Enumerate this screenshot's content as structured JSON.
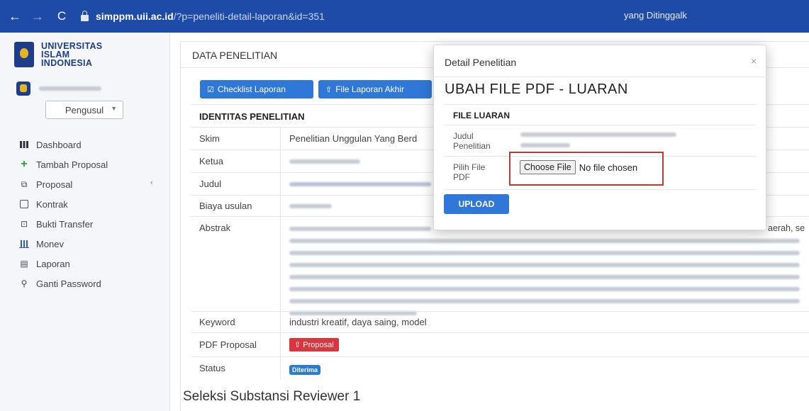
{
  "browser": {
    "back": "←",
    "forward": "→",
    "reload": "C",
    "url_host": "simppm.uii.ac.id",
    "url_path": "/?p=peneliti-detail-laporan&id=351",
    "cut_text": "yang Ditinggalk"
  },
  "sidebar": {
    "brand": [
      "UNIVERSITAS",
      "ISLAM",
      "INDONESIA"
    ],
    "role": "Pengusul",
    "items": [
      {
        "label": "Dashboard",
        "icon": "grid-icon"
      },
      {
        "label": "Tambah Proposal",
        "icon": "plus-icon"
      },
      {
        "label": "Proposal",
        "icon": "copy-icon"
      },
      {
        "label": "Kontrak",
        "icon": "file-icon"
      },
      {
        "label": "Bukti Transfer",
        "icon": "money-icon"
      },
      {
        "label": "Monev",
        "icon": "bar-chart-icon"
      },
      {
        "label": "Laporan",
        "icon": "document-icon"
      },
      {
        "label": "Ganti Password",
        "icon": "key-icon"
      }
    ]
  },
  "main": {
    "title": "DATA PENELITIAN",
    "btn_checklist": "Checklist Laporan",
    "btn_file": "File Laporan Akhir",
    "section_identitas": "IDENTITAS PENELITIAN",
    "rows": {
      "skim_label": "Skim",
      "skim_value": "Penelitian Unggulan Yang Berd",
      "ketua_label": "Ketua",
      "judul_label": "Judul",
      "biaya_label": "Biaya usulan",
      "abstrak_label": "Abstrak",
      "abstrak_cut": "aerah, se",
      "keyword_label": "Keyword",
      "keyword_value": "industri kreatif, daya saing, model",
      "pdf_label": "PDF Proposal",
      "pdf_button": "Proposal",
      "status_label": "Status",
      "status_value": "Diterima"
    },
    "section_reviewer": "Seleksi Substansi Reviewer 1"
  },
  "modal": {
    "title": "Detail Penelitian",
    "close": "×",
    "heading": "UBAH FILE PDF - LUARAN",
    "subheading": "FILE LUARAN",
    "judul_label_1": "Judul",
    "judul_label_2": "Penelitian",
    "pilih_label_1": "Pilih File",
    "pilih_label_2": "PDF",
    "choose_button": "Choose File",
    "no_file": "No file chosen",
    "upload_button": "UPLOAD"
  }
}
